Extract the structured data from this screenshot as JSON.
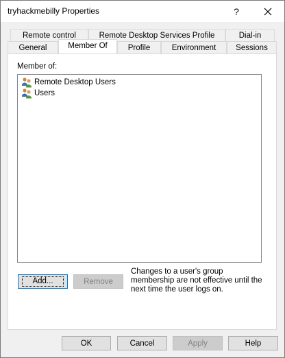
{
  "window": {
    "title": "tryhackmebilly Properties",
    "help_glyph": "?",
    "close_icon": "close-icon"
  },
  "tabs_back": [
    {
      "label": "Remote control"
    },
    {
      "label": "Remote Desktop Services Profile"
    },
    {
      "label": "Dial-in"
    }
  ],
  "tabs_front": [
    {
      "label": "General"
    },
    {
      "label": "Member Of",
      "selected": true
    },
    {
      "label": "Profile"
    },
    {
      "label": "Environment"
    },
    {
      "label": "Sessions"
    }
  ],
  "member_of": {
    "label": "Member of:",
    "items": [
      {
        "name": "Remote Desktop Users",
        "icon": "group-icon"
      },
      {
        "name": "Users",
        "icon": "group-icon"
      }
    ]
  },
  "actions": {
    "add_label": "Add...",
    "remove_label": "Remove",
    "note": "Changes to a user's group membership are not effective until the next time the user logs on."
  },
  "footer": {
    "ok_label": "OK",
    "cancel_label": "Cancel",
    "apply_label": "Apply",
    "help_label": "Help"
  }
}
